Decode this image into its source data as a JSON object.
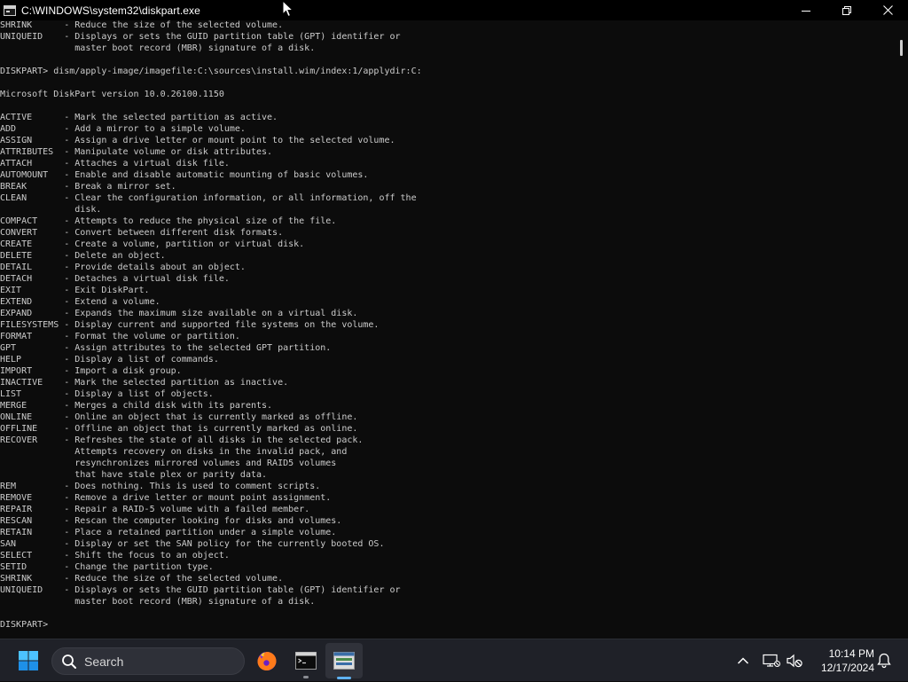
{
  "window": {
    "title": "C:\\WINDOWS\\system32\\diskpart.exe",
    "controls": {
      "minimize_icon": "minimize-icon",
      "maximize_icon": "maximize-icon",
      "close_icon": "close-icon"
    }
  },
  "console": {
    "lines": [
      "SHRINK      - Reduce the size of the selected volume.",
      "UNIQUEID    - Displays or sets the GUID partition table (GPT) identifier or",
      "              master boot record (MBR) signature of a disk.",
      "",
      "DISKPART> dism/apply-image/imagefile:C:\\sources\\install.wim/index:1/applydir:C:",
      "",
      "Microsoft DiskPart version 10.0.26100.1150",
      "",
      "ACTIVE      - Mark the selected partition as active.",
      "ADD         - Add a mirror to a simple volume.",
      "ASSIGN      - Assign a drive letter or mount point to the selected volume.",
      "ATTRIBUTES  - Manipulate volume or disk attributes.",
      "ATTACH      - Attaches a virtual disk file.",
      "AUTOMOUNT   - Enable and disable automatic mounting of basic volumes.",
      "BREAK       - Break a mirror set.",
      "CLEAN       - Clear the configuration information, or all information, off the",
      "              disk.",
      "COMPACT     - Attempts to reduce the physical size of the file.",
      "CONVERT     - Convert between different disk formats.",
      "CREATE      - Create a volume, partition or virtual disk.",
      "DELETE      - Delete an object.",
      "DETAIL      - Provide details about an object.",
      "DETACH      - Detaches a virtual disk file.",
      "EXIT        - Exit DiskPart.",
      "EXTEND      - Extend a volume.",
      "EXPAND      - Expands the maximum size available on a virtual disk.",
      "FILESYSTEMS - Display current and supported file systems on the volume.",
      "FORMAT      - Format the volume or partition.",
      "GPT         - Assign attributes to the selected GPT partition.",
      "HELP        - Display a list of commands.",
      "IMPORT      - Import a disk group.",
      "INACTIVE    - Mark the selected partition as inactive.",
      "LIST        - Display a list of objects.",
      "MERGE       - Merges a child disk with its parents.",
      "ONLINE      - Online an object that is currently marked as offline.",
      "OFFLINE     - Offline an object that is currently marked as online.",
      "RECOVER     - Refreshes the state of all disks in the selected pack.",
      "              Attempts recovery on disks in the invalid pack, and",
      "              resynchronizes mirrored volumes and RAID5 volumes",
      "              that have stale plex or parity data.",
      "REM         - Does nothing. This is used to comment scripts.",
      "REMOVE      - Remove a drive letter or mount point assignment.",
      "REPAIR      - Repair a RAID-5 volume with a failed member.",
      "RESCAN      - Rescan the computer looking for disks and volumes.",
      "RETAIN      - Place a retained partition under a simple volume.",
      "SAN         - Display or set the SAN policy for the currently booted OS.",
      "SELECT      - Shift the focus to an object.",
      "SETID       - Change the partition type.",
      "SHRINK      - Reduce the size of the selected volume.",
      "UNIQUEID    - Displays or sets the GUID partition table (GPT) identifier or",
      "              master boot record (MBR) signature of a disk.",
      "",
      "DISKPART> "
    ]
  },
  "taskbar": {
    "start_icon": "windows-start-icon",
    "search_placeholder": "Search",
    "pinned_apps": [
      {
        "name": "firefox",
        "icon": "firefox-icon",
        "running": false
      },
      {
        "name": "command-prompt",
        "icon": "terminal-icon",
        "running": true
      },
      {
        "name": "diskpart",
        "icon": "diskpart-icon",
        "running": true,
        "active": true
      }
    ],
    "tray": {
      "chevron_icon": "chevron-up-icon",
      "network_icon": "network-icon",
      "volume_icon": "volume-muted-icon",
      "notification_icon": "bell-icon"
    },
    "clock": {
      "time": "10:14 PM",
      "date": "12/17/2024"
    }
  },
  "colors": {
    "console_bg": "#0c0c0c",
    "console_fg": "#cccccc",
    "titlebar_bg": "#000000",
    "taskbar_bg": "#1f2128",
    "accent": "#5fb2f2"
  }
}
